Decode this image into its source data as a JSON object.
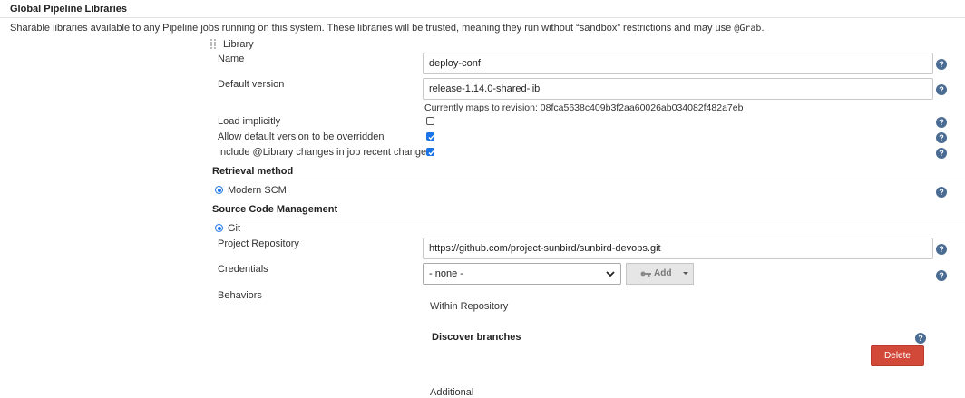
{
  "section": {
    "title": "Global Pipeline Libraries",
    "description": "Sharable libraries available to any Pipeline jobs running on this system. These libraries will be trusted, meaning they run without “sandbox” restrictions and may use ",
    "description_code": "@Grab",
    "description_end": "."
  },
  "library": {
    "header_label": "Library",
    "name_label": "Name",
    "name_value": "deploy-conf",
    "default_version_label": "Default version",
    "default_version_value": "release-1.14.0-shared-lib",
    "revision_text": "Currently maps to revision: 08fca5638c409b3f2aa60026ab034082f482a7eb",
    "load_implicitly_label": "Load implicitly",
    "load_implicitly_checked": false,
    "allow_override_label": "Allow default version to be overridden",
    "allow_override_checked": true,
    "include_changes_label": "Include @Library changes in job recent changes",
    "include_changes_checked": true
  },
  "retrieval": {
    "title": "Retrieval method",
    "option_label": "Modern SCM"
  },
  "scm": {
    "title": "Source Code Management",
    "option_label": "Git",
    "repo_label": "Project Repository",
    "repo_value": "https://github.com/project-sunbird/sunbird-devops.git",
    "credentials_label": "Credentials",
    "credentials_value": "- none -",
    "add_label": "Add",
    "behaviors_label": "Behaviors",
    "within_repo_label": "Within Repository",
    "discover_branches_label": "Discover branches",
    "delete_label": "Delete",
    "additional_label": "Additional"
  },
  "help_symbol": "?",
  "colors": {
    "accent": "#1a73e8",
    "danger": "#d24939",
    "help": "#4a6b92"
  }
}
